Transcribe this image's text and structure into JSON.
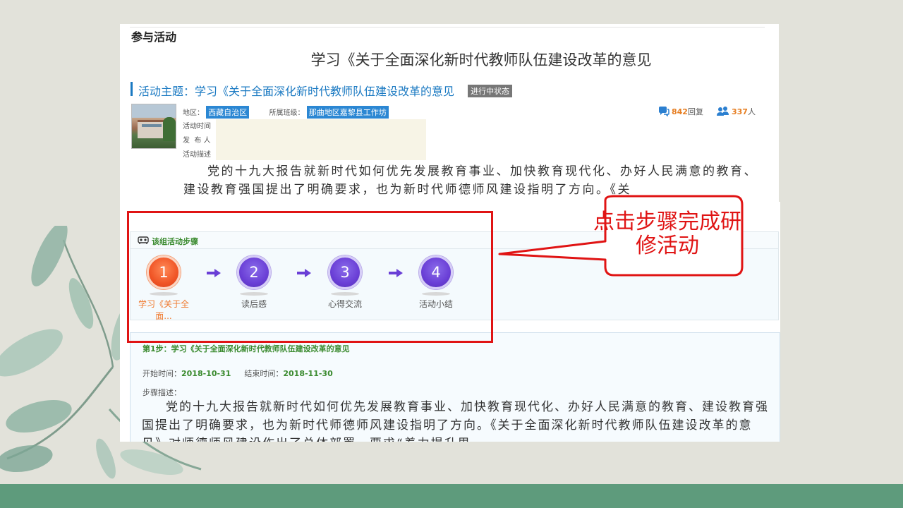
{
  "page": {
    "section_title": "参与活动",
    "main_title": "学习《关于全面深化新时代教师队伍建设改革的意见",
    "theme_line": "活动主题：学习《关于全面深化新时代教师队伍建设改革的意见",
    "status_badge": "进行中状态"
  },
  "meta": {
    "region_label": "地区：",
    "region_value": "西藏自治区",
    "class_label": "所属班级：",
    "class_value": "那曲地区嘉黎县工作坊",
    "time_label": "活动时间",
    "publisher_label": "发  布 人",
    "desc_label": "活动描述"
  },
  "stats": {
    "replies_count": "842",
    "replies_unit": "回复",
    "people_count": "337",
    "people_unit": "人"
  },
  "activity_desc": "党的十九大报告就新时代如何优先发展教育事业、加快教育现代化、办好人民满意的教育、建设教育强国提出了明确要求，也为新时代师德师风建设指明了方向。《关",
  "steps_panel": {
    "heading": "该组活动步骤",
    "steps": [
      {
        "num": "1",
        "label": "学习《关于全面...",
        "active": true
      },
      {
        "num": "2",
        "label": "读后感",
        "active": false
      },
      {
        "num": "3",
        "label": "心得交流",
        "active": false
      },
      {
        "num": "4",
        "label": "活动小结",
        "active": false
      }
    ]
  },
  "step_detail": {
    "title": "第1步：学习《关于全面深化新时代教师队伍建设改革的意见",
    "start_label": "开始时间：",
    "start_value": "2018-10-31",
    "end_label": "结束时间：",
    "end_value": "2018-11-30",
    "desc_label": "步骤描述：",
    "desc_text": "党的十九大报告就新时代如何优先发展教育事业、加快教育现代化、办好人民满意的教育、建设教育强国提出了明确要求，也为新时代师德师风建设指明了方向。《关于全面深化新时代教师队伍建设改革的意见》对师德师风建设作出了总体部署，要求“着力提升思"
  },
  "annotation": {
    "callout_text": "点击步骤完成研修活动",
    "color": "#e01414"
  },
  "colors": {
    "background": "#e2e2da",
    "bottom_band": "#5e9b7c",
    "link_blue": "#1a79c2",
    "step_purple": "#6a3fd6",
    "step_active": "#f05526",
    "green_text": "#3a8a2e"
  }
}
